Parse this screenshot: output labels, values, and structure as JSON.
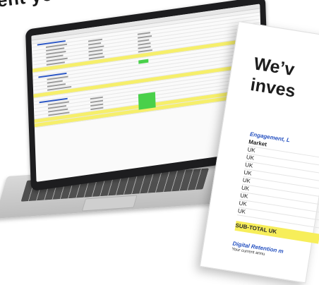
{
  "headline": "ent you need",
  "doc": {
    "title_line1": "We’v",
    "title_line2": "inves",
    "section_header": "Engagement, L",
    "market_label": "Market",
    "rows": [
      "UK",
      "UK",
      "UK",
      "UK",
      "UK",
      "UK",
      "UK",
      "UK",
      "UK"
    ],
    "subtotal_label": "SUB-TOTAL UK",
    "section2_header": "Digital Retention m",
    "small_text": "Your current annu"
  },
  "colors": {
    "highlight_yellow": "#f7ee5a",
    "blue_header": "#2450c0",
    "green_cell": "#49d04a",
    "laptop_bezel": "#1d1d1f"
  }
}
